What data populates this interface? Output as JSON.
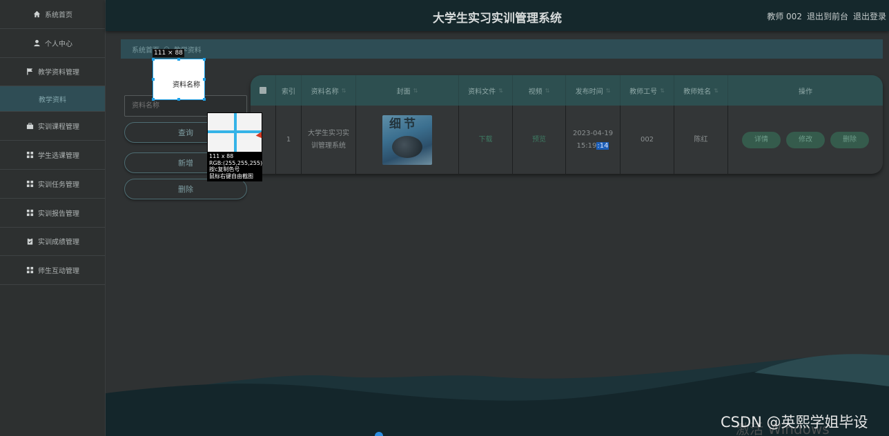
{
  "header": {
    "title": "大学生实习实训管理系统",
    "user": "教师 002",
    "front_link": "退出到前台",
    "logout": "退出登录"
  },
  "sidebar": {
    "items": [
      {
        "label": "系统首页",
        "icon": "home-icon"
      },
      {
        "label": "个人中心",
        "icon": "person-icon"
      },
      {
        "label": "教学资料管理",
        "icon": "flag-icon"
      },
      {
        "label": "教学资料",
        "icon": ""
      },
      {
        "label": "实训课程管理",
        "icon": "briefcase-icon"
      },
      {
        "label": "学生选课管理",
        "icon": "grid-icon"
      },
      {
        "label": "实训任务管理",
        "icon": "grid-icon"
      },
      {
        "label": "实训报告管理",
        "icon": "grid-icon"
      },
      {
        "label": "实训成绩管理",
        "icon": "clipboard-icon"
      },
      {
        "label": "师生互动管理",
        "icon": "grid-icon"
      }
    ]
  },
  "breadcrumb": {
    "home": "系统首页",
    "separator": "○",
    "current": "教学资料"
  },
  "search": {
    "placeholder": "资料名称",
    "query_label": "查询",
    "add_label": "新增",
    "delete_label": "删除"
  },
  "table": {
    "headers": [
      "索引",
      "资料名称",
      "封面",
      "资料文件",
      "视频",
      "发布时间",
      "教师工号",
      "教师姓名",
      "操作"
    ],
    "rows": [
      {
        "index": "1",
        "name_line1": "大学生实习实",
        "name_line2": "训管理系统",
        "cover_text": "细节",
        "file": "下载",
        "video": "预览",
        "date": "2023-04-19",
        "time_prefix": "15:19",
        "time_suffix": ":14",
        "teacher_id": "002",
        "teacher_name": "陈红",
        "actions": [
          "详情",
          "修改",
          "删除"
        ]
      }
    ]
  },
  "overlay": {
    "size_tag": "111 × 88",
    "selection_label": "资料名称",
    "mag_size": "111 x 88",
    "mag_rgb": "RGB:(255,255,255)",
    "mag_hint1": "按c复制色号",
    "mag_hint2": "鼠标右键自由截图"
  },
  "watermark": {
    "windows": "激活 Windows",
    "csdn": "CSDN @英熙学姐毕设"
  }
}
